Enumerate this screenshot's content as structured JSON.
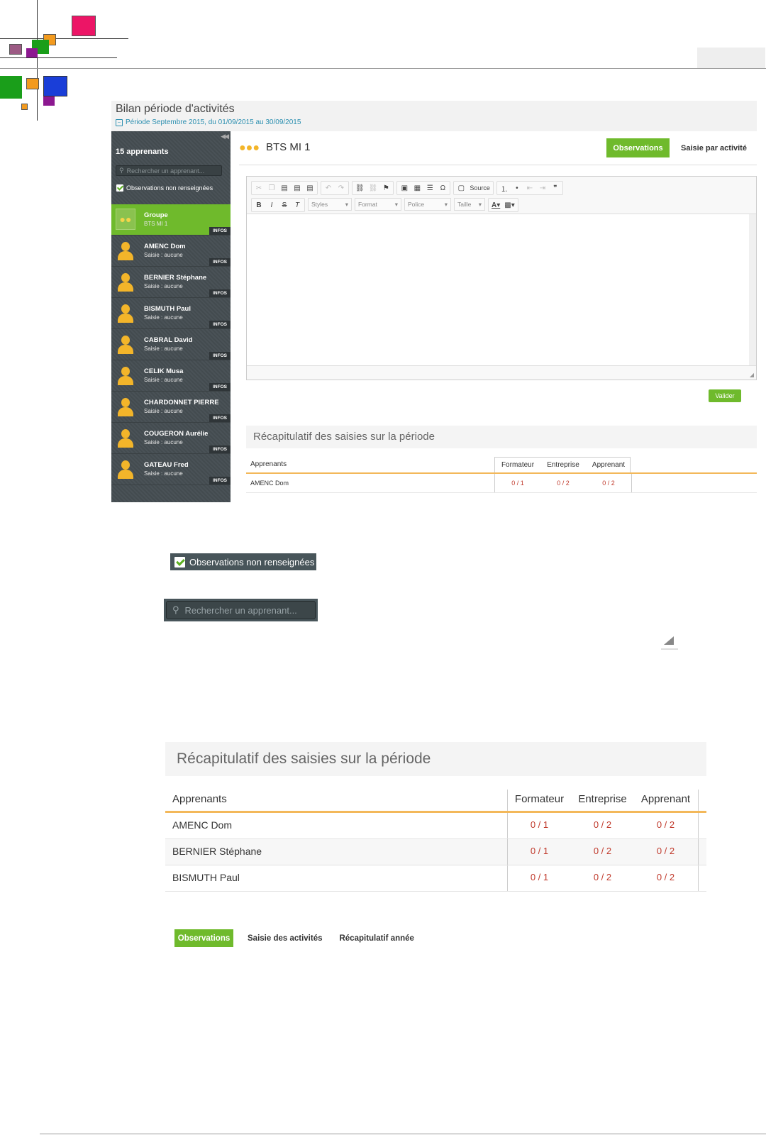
{
  "colors": {
    "accent": "#6fba2c",
    "sidebar": "#434b4f",
    "underline": "#f3b85a",
    "score": "#c0392b",
    "link": "#2b8fb0"
  },
  "page": {
    "title": "Bilan période d'activités",
    "period": "Période Septembre 2015, du 01/09/2015 au 30/09/2015"
  },
  "sidebar": {
    "collapse_icon": "double-chevron-left-icon",
    "count": "15 apprenants",
    "search_placeholder": "Rechercher un apprenant...",
    "filter_label": "Observations non renseignées",
    "infos_label": "INFOS",
    "items": [
      {
        "name": "Groupe",
        "sub": "BTS MI 1"
      },
      {
        "name": "AMENC Dom",
        "sub": "Saisie : aucune"
      },
      {
        "name": "BERNIER Stéphane",
        "sub": "Saisie : aucune"
      },
      {
        "name": "BISMUTH Paul",
        "sub": "Saisie : aucune"
      },
      {
        "name": "CABRAL David",
        "sub": "Saisie : aucune"
      },
      {
        "name": "CELIK Musa",
        "sub": "Saisie : aucune"
      },
      {
        "name": "CHARDONNET PIERRE",
        "sub": "Saisie : aucune"
      },
      {
        "name": "COUGERON Aurélie",
        "sub": "Saisie : aucune"
      },
      {
        "name": "GATEAU Fred",
        "sub": "Saisie : aucune"
      }
    ]
  },
  "main": {
    "group_title": "BTS MI 1",
    "tab_observations": "Observations",
    "tab_activity": "Saisie par activité",
    "toolbar": {
      "source": "Source",
      "styles": "Styles",
      "format": "Format",
      "police": "Police",
      "taille": "Taille"
    },
    "validate": "Valider"
  },
  "recap": {
    "title": "Récapitulatif des saisies sur la période",
    "headers": [
      "Apprenants",
      "Formateur",
      "Entreprise",
      "Apprenant"
    ],
    "rows": [
      [
        "AMENC Dom",
        "0 / 1",
        "0 / 2",
        "0 / 2"
      ],
      [
        "BERNIER Stéphane",
        "0 / 1",
        "0 / 2",
        "0 / 2"
      ],
      [
        "BISMUTH Paul",
        "0 / 1",
        "0 / 2",
        "0 / 2"
      ]
    ]
  },
  "bottom_tabs": [
    "Observations",
    "Saisie des activités",
    "Récapitulatif année"
  ]
}
